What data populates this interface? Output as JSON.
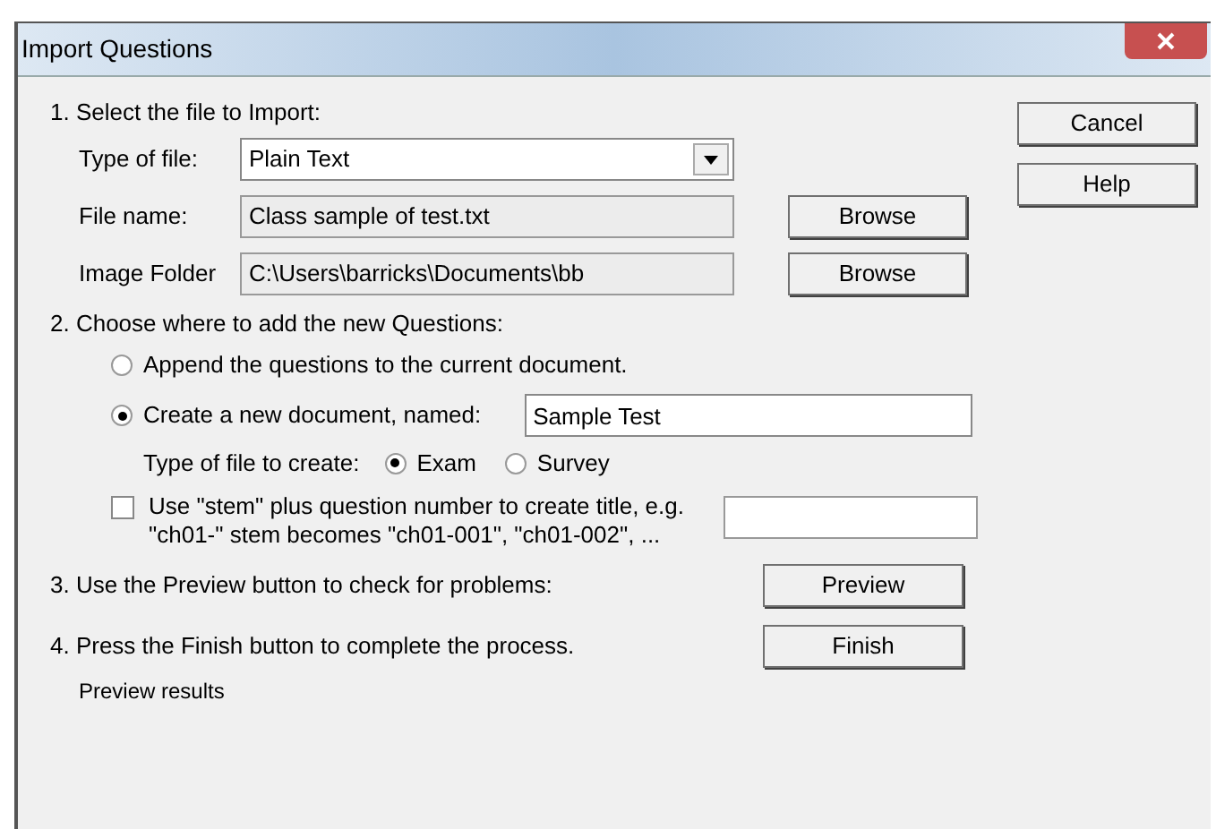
{
  "window": {
    "title": "Import Questions"
  },
  "side_buttons": [
    "Cancel",
    "Help"
  ],
  "step1": {
    "heading": "1.  Select the file to Import:",
    "type_of_file": {
      "label": "Type of file:",
      "value": "Plain Text"
    },
    "file_name": {
      "label": "File name:",
      "value": "Class sample of test.txt",
      "button": "Browse"
    },
    "image_folder": {
      "label": "Image Folder",
      "value": "C:\\Users\\barricks\\Documents\\bb",
      "button": "Browse"
    }
  },
  "step2": {
    "heading": "2.  Choose where to add the new Questions:",
    "options": [
      {
        "label": "Append the questions to the current document.",
        "selected": false
      },
      {
        "label": "Create a new document, named:",
        "selected": true,
        "value": "Sample Test"
      }
    ],
    "type_label": "Type of file to create:",
    "types": [
      {
        "label": "Exam",
        "selected": true
      },
      {
        "label": "Survey",
        "selected": false
      }
    ],
    "stem": {
      "checked": false,
      "line1": "Use \"stem\" plus question number to create title,  e.g.",
      "line2": "\"ch01-\" stem becomes \"ch01-001\",  \"ch01-002\",  ..."
    }
  },
  "step3": {
    "text": "3.  Use the Preview button to check for problems:",
    "button": "Preview"
  },
  "step4": {
    "text": "4.  Press the Finish button to complete the process.",
    "button": "Finish"
  },
  "footer": "Preview results"
}
